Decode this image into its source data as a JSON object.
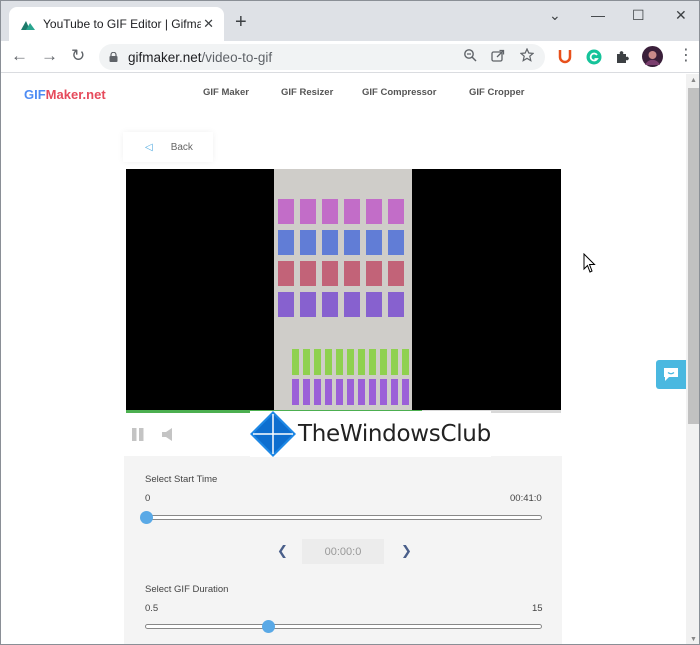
{
  "browser": {
    "tab_title": "YouTube to GIF Editor | Gifmaker.net",
    "tab_close": "✕",
    "new_tab": "+",
    "window_controls": [
      "⌄",
      "—",
      "☐",
      "✕"
    ],
    "url_domain": "gifmaker.net",
    "url_path": "/video-to-gif",
    "nav": {
      "back": "←",
      "forward": "→",
      "reload": "↻"
    },
    "omnibox_icons": [
      "zoom-icon",
      "share-icon",
      "star-icon"
    ],
    "extensions": [
      "ublock-icon",
      "grammarly-icon",
      "puzzle-icon",
      "profile-avatar",
      "menu-icon"
    ],
    "menu": "⋮"
  },
  "site": {
    "logo_g": "GIF",
    "logo_rest": "Maker.net",
    "nav_items": [
      "GIF Maker",
      "GIF Resizer",
      "GIF Compressor",
      "GIF Cropper"
    ],
    "back_label": "Back"
  },
  "player": {
    "progress": 0.68,
    "icons": [
      "pause-icon",
      "volume-icon"
    ]
  },
  "watermark": {
    "text": "TheWindowsClub"
  },
  "start_time": {
    "label": "Select Start Time",
    "min": "0",
    "max": "00:41:0",
    "value": 0,
    "display": "00:00:0"
  },
  "duration": {
    "label": "Select GIF Duration",
    "min": "0.5",
    "max": "15",
    "value": 0.31
  },
  "colors": {
    "logo_red": "#e64a5b",
    "logo_blue": "#4e8cf4",
    "accent": "#5aa9e6",
    "chat": "#4ab8e0",
    "progress": "#4caf50"
  }
}
